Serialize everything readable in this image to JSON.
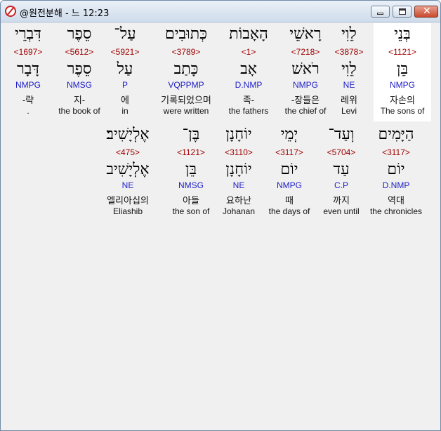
{
  "window": {
    "title": "@원전분해 - 느 12:23",
    "buttons": {
      "minimize": "",
      "maximize": "",
      "close": "✕"
    }
  },
  "rows": [
    [
      {
        "heb": "בְּנֵי",
        "strong": "<1121>",
        "lemma": "בֵּן",
        "morph": "NMPG",
        "kor": "자손의",
        "eng": "The sons of",
        "selected": true
      },
      {
        "heb": "לֵוִי",
        "strong": "<3878>",
        "lemma": "לֵוִי",
        "morph": "NE",
        "kor": "레위",
        "eng": "Levi"
      },
      {
        "heb": "רָאשֵׁי",
        "strong": "<7218>",
        "lemma": "רֹאשׁ",
        "morph": "NMPG",
        "kor": "-장들은",
        "eng": "the chief of"
      },
      {
        "heb": "הָאָבוֹת",
        "strong": "<1>",
        "lemma": "אָב",
        "morph": "D.NMP",
        "kor": "족-",
        "eng": "the fathers"
      },
      {
        "heb": "כְּתוּבִים",
        "strong": "<3789>",
        "lemma": "כָּתַב",
        "morph": "VQPPMP",
        "kor": "기록되었으며",
        "eng": "were written"
      },
      {
        "heb": "עַל־",
        "strong": "<5921>",
        "lemma": "עַל",
        "morph": "P",
        "kor": "에",
        "eng": "in"
      },
      {
        "heb": "סֵפֶר",
        "strong": "<5612>",
        "lemma": "סֵפֶר",
        "morph": "NMSG",
        "kor": "지-",
        "eng": "the book of"
      },
      {
        "heb": "דִּבְרֵי",
        "strong": "<1697>",
        "lemma": "דָּבָר",
        "morph": "NMPG",
        "kor": "-략",
        "eng": "."
      }
    ],
    [
      {
        "heb": "הַיָּמִים",
        "strong": "<3117>",
        "lemma": "יוֹם",
        "morph": "D.NMP",
        "kor": "역대",
        "eng": "the chronicles"
      },
      {
        "heb": "וְעַד־",
        "strong": "<5704>",
        "lemma": "עַד",
        "morph": "C.P",
        "kor": "까지",
        "eng": "even until"
      },
      {
        "heb": "יְמֵי",
        "strong": "<3117>",
        "lemma": "יוֹם",
        "morph": "NMPG",
        "kor": "때",
        "eng": "the days of"
      },
      {
        "heb": "יוֹחָנָן",
        "strong": "<3110>",
        "lemma": "יוֹחָנָן",
        "morph": "NE",
        "kor": "요하난",
        "eng": "Johanan"
      },
      {
        "heb": "בֶּן־",
        "strong": "<1121>",
        "lemma": "בֵּן",
        "morph": "NMSG",
        "kor": "아들",
        "eng": "the son of"
      },
      {
        "heb": "אֶלְיָשִׁיב׃",
        "strong": "<475>",
        "lemma": "אֶלְיָשִׁיב",
        "morph": "NE",
        "kor": "엘리아십의",
        "eng": "Eliashib"
      }
    ]
  ]
}
